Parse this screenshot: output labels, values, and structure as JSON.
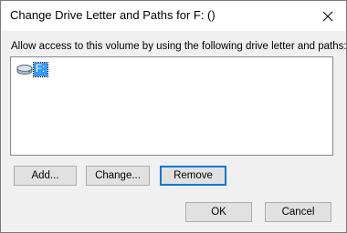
{
  "window": {
    "title": "Change Drive Letter and Paths for F: ()"
  },
  "prompt": "Allow access to this volume by using the following drive letter and paths:",
  "paths_list": {
    "items": [
      {
        "label": "F:",
        "icon": "drive-icon",
        "selected": true
      }
    ]
  },
  "buttons": {
    "add": "Add...",
    "change": "Change...",
    "remove": "Remove",
    "ok": "OK",
    "cancel": "Cancel"
  },
  "colors": {
    "selection": "#3399ff",
    "default_button_border": "#0078d7",
    "dialog_background": "#f0f0f0"
  }
}
